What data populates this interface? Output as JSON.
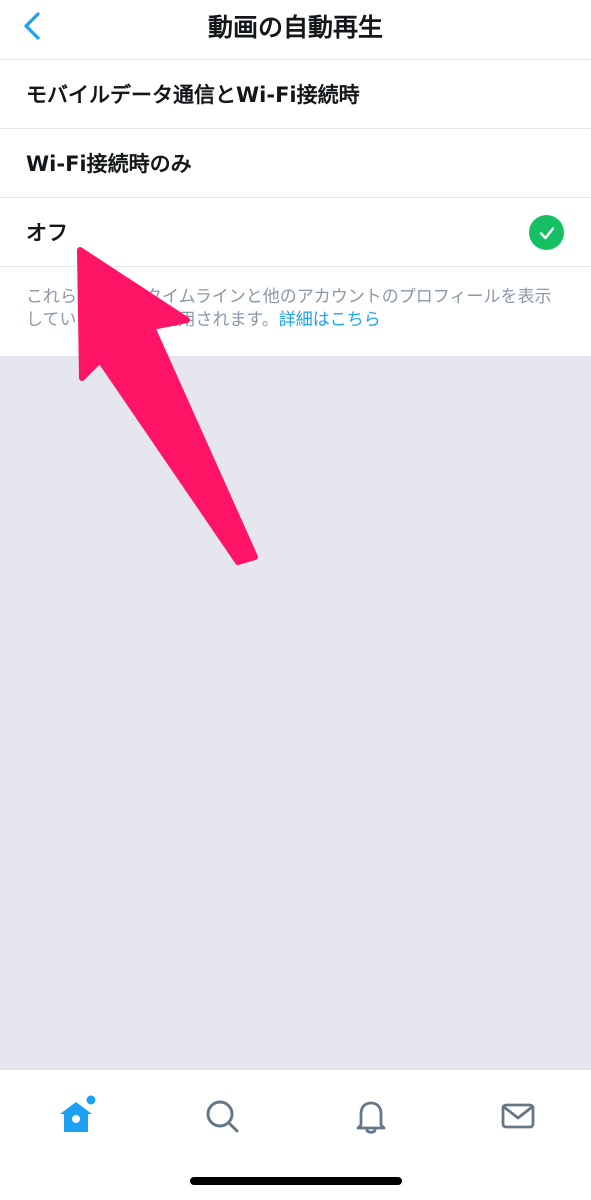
{
  "header": {
    "title": "動画の自動再生",
    "back_icon": "chevron-left-icon"
  },
  "options": [
    {
      "label": "モバイルデータ通信とWi-Fi接続時",
      "selected": false
    },
    {
      "label": "Wi-Fi接続時のみ",
      "selected": false
    },
    {
      "label": "オフ",
      "selected": true
    }
  ],
  "note": {
    "text": "これらの設定はタイムラインと他のアカウントのプロフィールを表示しているときのみ適用されます。",
    "link": "詳細はこちら"
  },
  "tabbar": {
    "tabs": [
      {
        "name": "home",
        "icon": "home-icon",
        "active": true,
        "badge_dot": true
      },
      {
        "name": "search",
        "icon": "search-icon",
        "active": false
      },
      {
        "name": "notifications",
        "icon": "bell-icon",
        "active": false
      },
      {
        "name": "messages",
        "icon": "mail-icon",
        "active": false
      }
    ]
  },
  "colors": {
    "accent": "#1da1f2",
    "check": "#17bf63",
    "arrow": "#ff1466",
    "text": "#14171a",
    "muted": "#8b98a5",
    "background_gray": "#e6e7ee"
  }
}
